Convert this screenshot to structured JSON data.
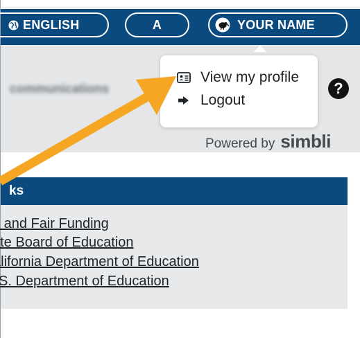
{
  "header": {
    "language_label": "ENGLISH",
    "font_size_label": "A",
    "user_label": "YOUR NAME"
  },
  "user_menu": {
    "items": [
      {
        "label": "View my profile",
        "icon": "id-card-icon"
      },
      {
        "label": "Logout",
        "icon": "sign-out-icon"
      }
    ]
  },
  "banner": {
    "blurred_text": "communications",
    "help_label": "?",
    "powered_by_label": "Powered by",
    "powered_by_brand": "simbli"
  },
  "links": {
    "header": "ks",
    "items": [
      "ull and Fair Funding",
      "ate Board of Education",
      "alifornia Department of Education",
      "S. Department of Education"
    ]
  },
  "colors": {
    "header_blue": "#0b4a7f",
    "band_grey": "#e4e6e8",
    "arrow_orange": "#f5a623"
  }
}
